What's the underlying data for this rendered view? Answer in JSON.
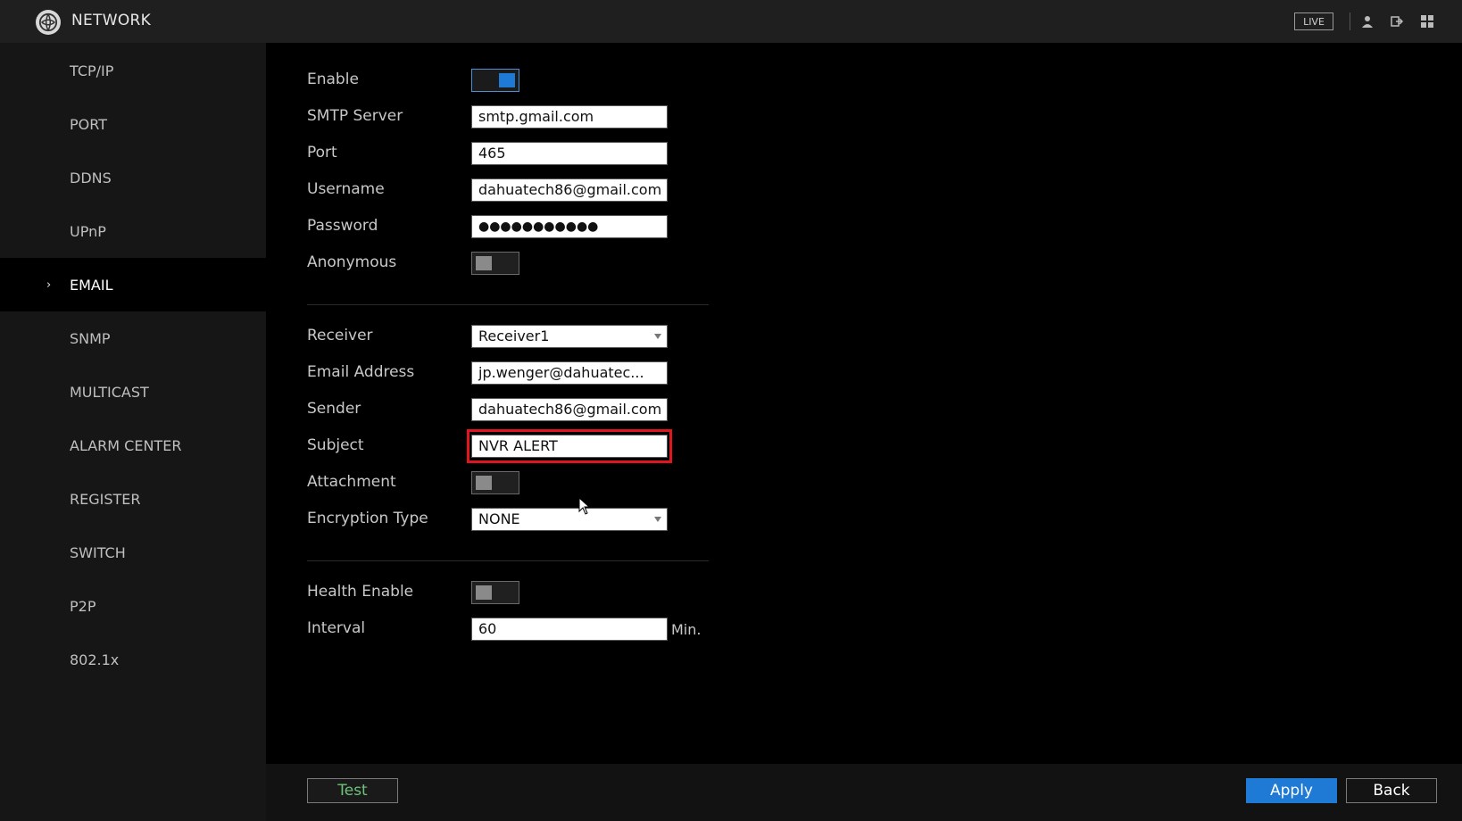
{
  "header": {
    "title": "NETWORK",
    "live_label": "LIVE",
    "icons": [
      "user-icon",
      "logout-icon",
      "grid-menu-icon"
    ]
  },
  "sidebar": {
    "items": [
      {
        "label": "TCP/IP",
        "active": false
      },
      {
        "label": "PORT",
        "active": false
      },
      {
        "label": "DDNS",
        "active": false
      },
      {
        "label": "UPnP",
        "active": false
      },
      {
        "label": "EMAIL",
        "active": true
      },
      {
        "label": "SNMP",
        "active": false
      },
      {
        "label": "MULTICAST",
        "active": false
      },
      {
        "label": "ALARM CENTER",
        "active": false
      },
      {
        "label": "REGISTER",
        "active": false
      },
      {
        "label": "SWITCH",
        "active": false
      },
      {
        "label": "P2P",
        "active": false
      },
      {
        "label": "802.1x",
        "active": false
      }
    ]
  },
  "form": {
    "enable": {
      "label": "Enable",
      "on": true
    },
    "smtp_server": {
      "label": "SMTP Server",
      "value": "smtp.gmail.com"
    },
    "port": {
      "label": "Port",
      "value": "465"
    },
    "username": {
      "label": "Username",
      "value": "dahuatech86@gmail.com"
    },
    "password": {
      "label": "Password",
      "value": "●●●●●●●●●●●"
    },
    "anonymous": {
      "label": "Anonymous",
      "on": false
    },
    "receiver": {
      "label": "Receiver",
      "value": "Receiver1"
    },
    "email_address": {
      "label": "Email Address",
      "value": "jp.wenger@dahuatec..."
    },
    "sender": {
      "label": "Sender",
      "value": "dahuatech86@gmail.com"
    },
    "subject": {
      "label": "Subject",
      "value": "NVR ALERT"
    },
    "attachment": {
      "label": "Attachment",
      "on": false
    },
    "encryption_type": {
      "label": "Encryption Type",
      "value": "NONE"
    },
    "health_enable": {
      "label": "Health Enable",
      "on": false
    },
    "interval": {
      "label": "Interval",
      "value": "60",
      "unit": "Min."
    }
  },
  "footer": {
    "test_label": "Test",
    "apply_label": "Apply",
    "back_label": "Back"
  },
  "colors": {
    "accent": "#1f7ad6",
    "highlight": "#e0161f",
    "test_text": "#6ec27a"
  }
}
